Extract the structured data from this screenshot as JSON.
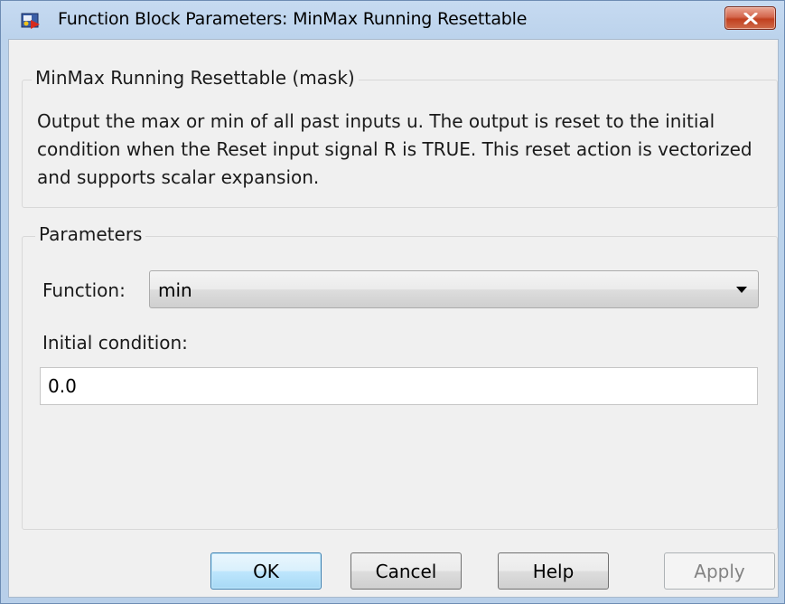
{
  "window": {
    "title": "Function Block Parameters: MinMax Running Resettable",
    "app_icon": "simulink-block-icon",
    "close_icon": "close-icon"
  },
  "mask_group": {
    "legend": "MinMax Running Resettable (mask)",
    "description": "Output the max or min of all past inputs u.  The output is reset to the initial condition when the Reset input signal R is TRUE.  This reset action is vectorized and supports scalar expansion."
  },
  "parameters_group": {
    "legend": "Parameters",
    "function_label": "Function:",
    "function_value": "min",
    "initial_condition_label": "Initial condition:",
    "initial_condition_value": "0.0"
  },
  "buttons": {
    "ok": "OK",
    "cancel": "Cancel",
    "help": "Help",
    "apply": "Apply"
  },
  "colors": {
    "title_bar": "#bcd3ec",
    "close_button": "#c9492a",
    "default_button_border": "#3c7fb1",
    "dialog_background": "#f0f0f0"
  }
}
